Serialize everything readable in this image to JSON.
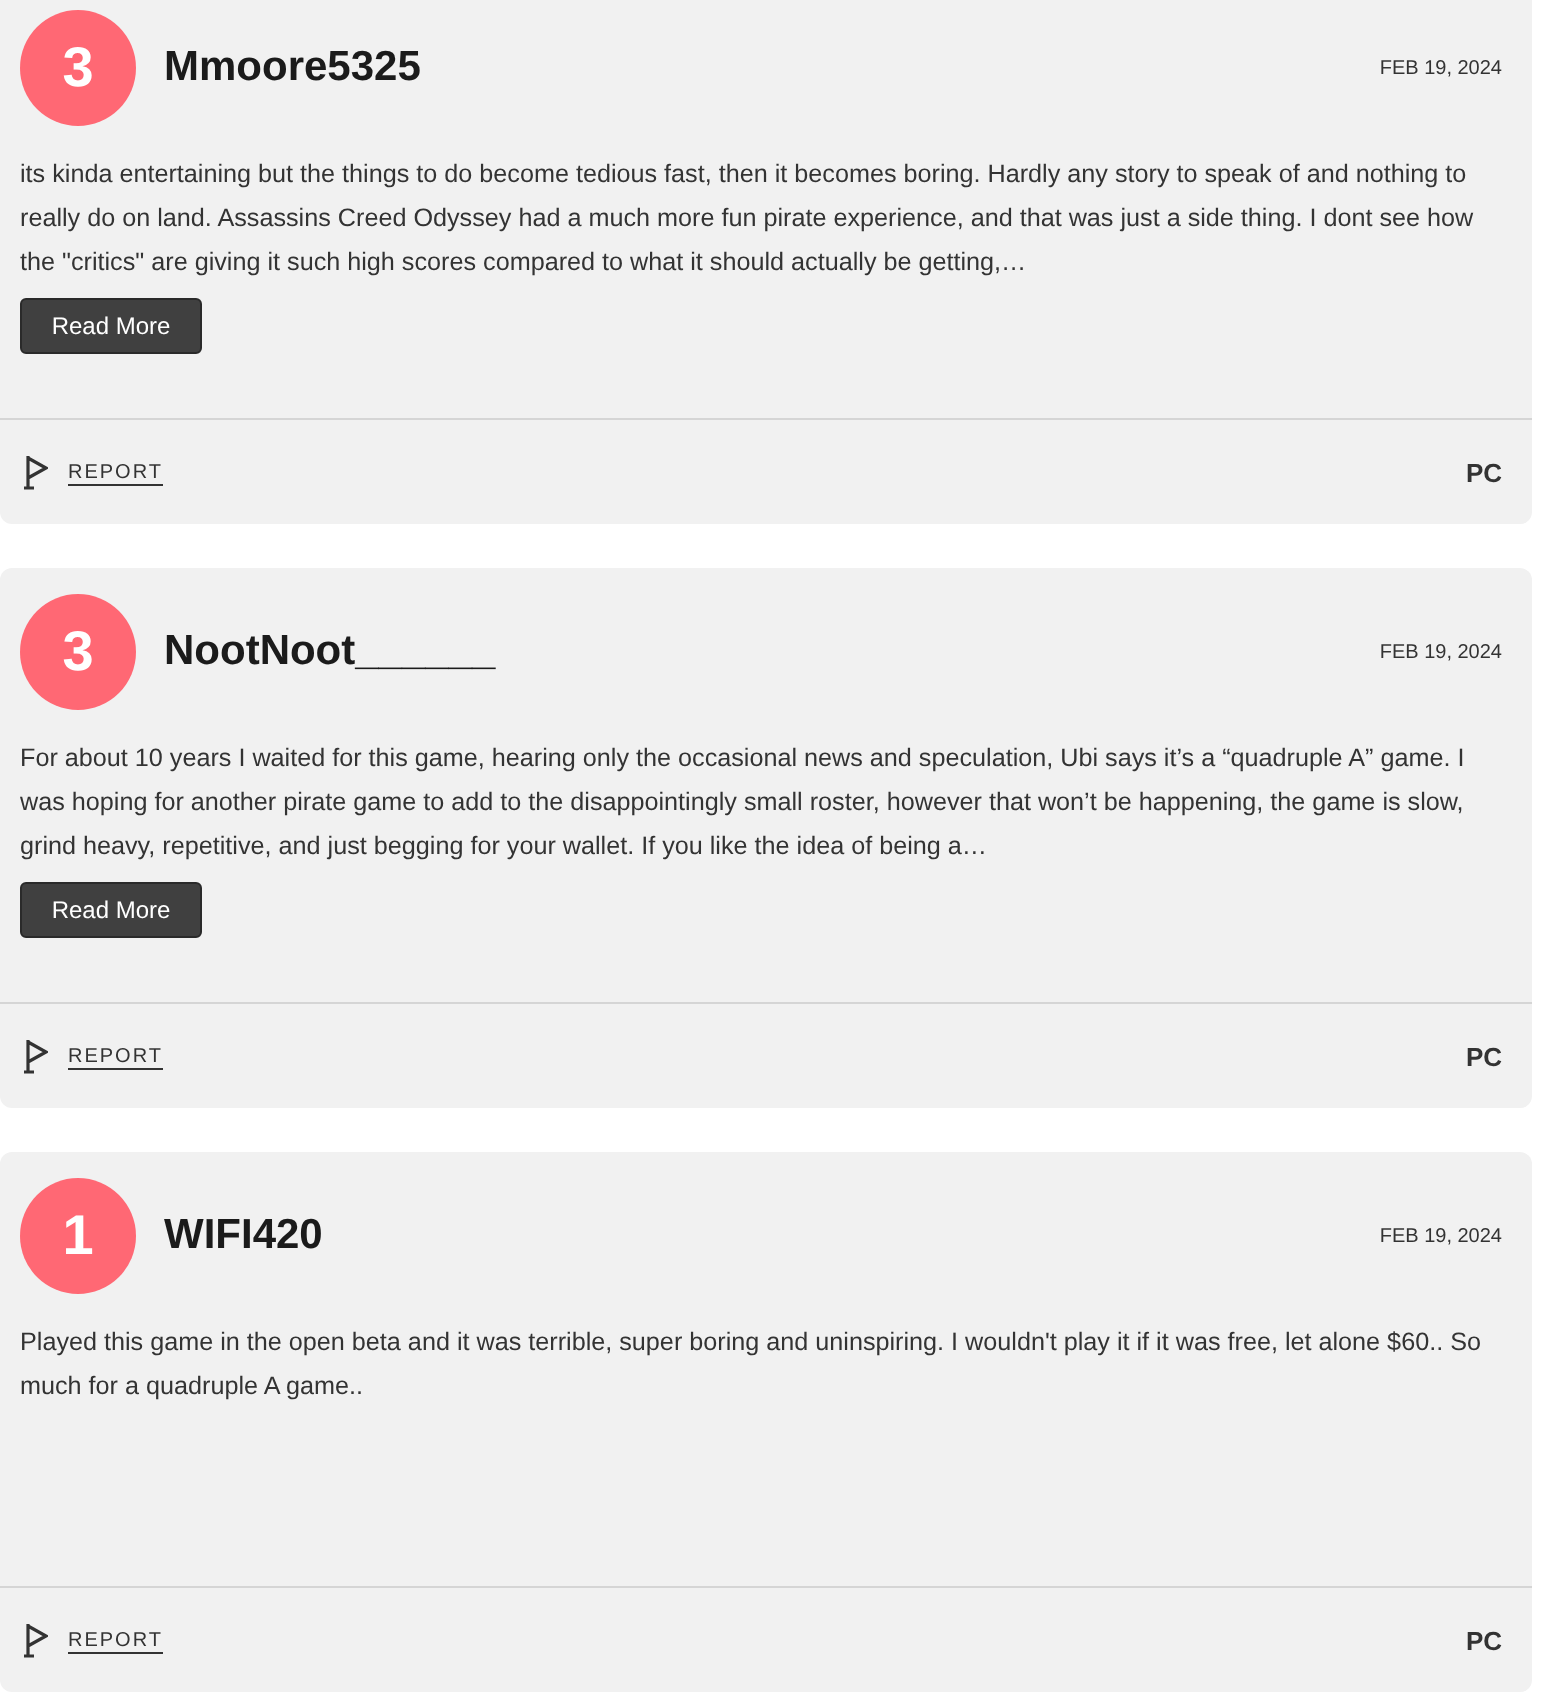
{
  "reviews": [
    {
      "score": "3",
      "author": "Mmoore5325",
      "date": "FEB 19, 2024",
      "text": "its kinda entertaining but the things to do become tedious fast, then it becomes boring. Hardly any story to speak of and nothing to really do on land. Assassins Creed Odyssey had a much more fun pirate experience, and that was just a side thing. I dont see how the \"critics\" are giving it such high scores compared to what it should actually be getting,…",
      "read_more": "Read More",
      "report": "REPORT",
      "platform": "PC"
    },
    {
      "score": "3",
      "author": "NootNoot______",
      "date": "FEB 19, 2024",
      "text": "For about 10 years I waited for this game, hearing only the occasional news and speculation, Ubi says it’s a “quadruple A” game. I was hoping for another pirate game to add to the disappointingly small roster, however that won’t be happening, the game is slow, grind heavy, repetitive, and just begging for your wallet. If you like the idea of being a…",
      "read_more": "Read More",
      "report": "REPORT",
      "platform": "PC"
    },
    {
      "score": "1",
      "author": "WIFI420",
      "date": "FEB 19, 2024",
      "text": "Played this game in the open beta and it was terrible, super boring and uninspiring. I wouldn't play it if it was free, let alone $60.. So much for a quadruple A game..",
      "report": "REPORT",
      "platform": "PC"
    }
  ]
}
